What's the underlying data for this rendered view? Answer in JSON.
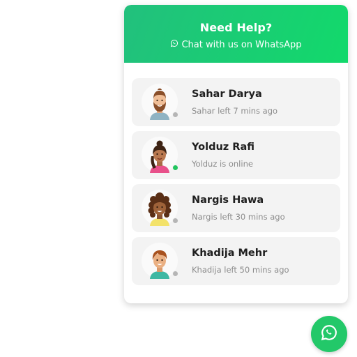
{
  "header": {
    "title": "Need Help?",
    "subtitle": "Chat with us on WhatsApp",
    "icon": "whatsapp-icon"
  },
  "colors": {
    "header_start": "#22c07d",
    "header_end": "#12d96b",
    "online": "#22c55e",
    "offline": "#b5b5b5",
    "fab": "#23c869"
  },
  "agents": [
    {
      "name": "Sahar Darya",
      "status": "Sahar left 7 mins ago",
      "online": false,
      "avatar": "bearded-man-avatar"
    },
    {
      "name": "Yolduz Rafi",
      "status": "Yolduz is online",
      "online": true,
      "avatar": "woman-braid-avatar"
    },
    {
      "name": "Nargis Hawa",
      "status": "Nargis left 30 mins ago",
      "online": false,
      "avatar": "curly-hair-woman-avatar"
    },
    {
      "name": "Khadija Mehr",
      "status": "Khadija left 50 mins ago",
      "online": false,
      "avatar": "young-man-avatar"
    }
  ],
  "fab": {
    "icon": "whatsapp-icon"
  }
}
